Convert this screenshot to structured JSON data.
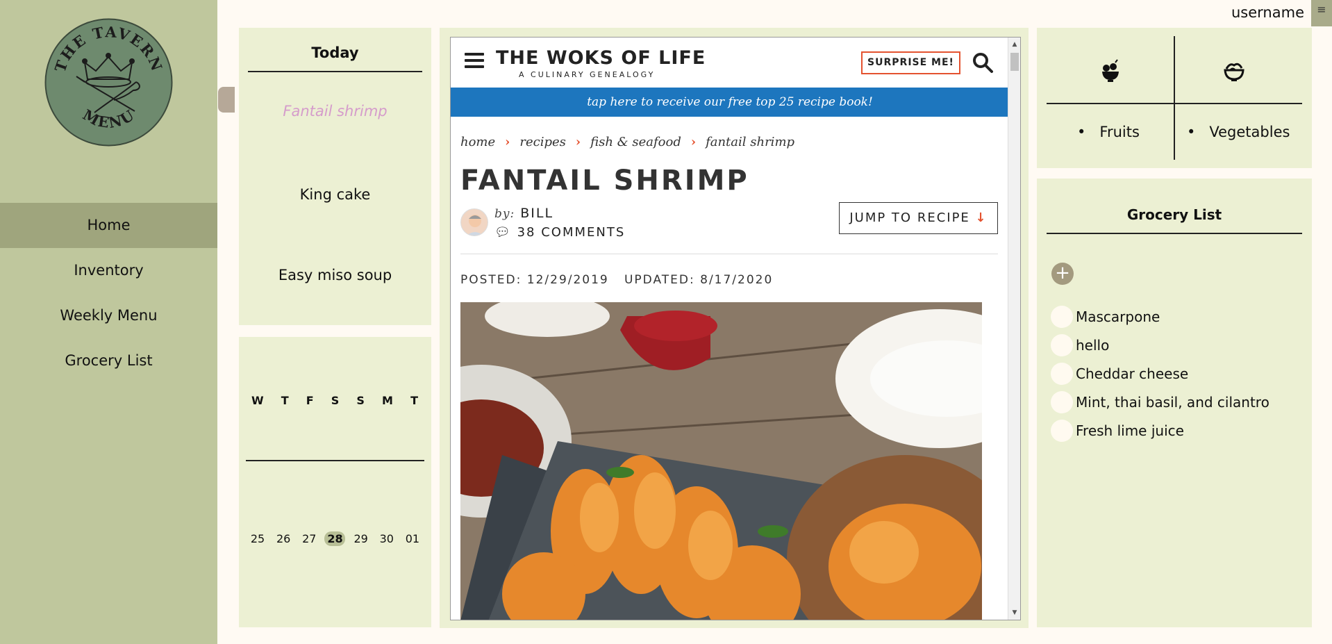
{
  "sidebar": {
    "logo": {
      "top_text": "THE TAVERN",
      "bottom_text": "MENU"
    },
    "nav": [
      {
        "label": "Home",
        "active": true
      },
      {
        "label": "Inventory",
        "active": false
      },
      {
        "label": "Weekly Menu",
        "active": false
      },
      {
        "label": "Grocery List",
        "active": false
      }
    ]
  },
  "topbar": {
    "username": "username",
    "menu_icon": "≡"
  },
  "today": {
    "title": "Today",
    "dishes": [
      "Fantail shrimp",
      "King cake",
      "Easy miso soup"
    ]
  },
  "calendar": {
    "weekdays": [
      "W",
      "T",
      "F",
      "S",
      "S",
      "M",
      "T"
    ],
    "dates": [
      "25",
      "26",
      "27",
      "28",
      "29",
      "30",
      "01"
    ],
    "current_date": "28"
  },
  "browser": {
    "site_title": "THE WOKS OF LIFE",
    "site_subtitle": "A CULINARY GENEALOGY",
    "surprise_button": "SURPRISE ME!",
    "banner": "tap here to receive our free top 25 recipe book!",
    "breadcrumb": [
      "home",
      "recipes",
      "fish & seafood",
      "fantail shrimp"
    ],
    "recipe_title": "FANTAIL SHRIMP",
    "by_label": "by:",
    "author": "BILL",
    "comments": "38 COMMENTS",
    "jump_button": "JUMP TO RECIPE",
    "posted": "POSTED: 12/29/2019",
    "updated": "UPDATED: 8/17/2020"
  },
  "categories": [
    {
      "label": "Fruits",
      "icon": "fruit-bowl-icon"
    },
    {
      "label": "Vegetables",
      "icon": "salad-bowl-icon"
    }
  ],
  "grocery": {
    "title": "Grocery List",
    "add_label": "+",
    "items": [
      "Mascarpone",
      "hello",
      "Cheddar cheese",
      "Mint, thai basil, and cilantro",
      "Fresh lime juice"
    ]
  },
  "colors": {
    "sidebar_bg": "#bfc79d",
    "nav_active": "#9fa57d",
    "panel_bg": "#ecf0d3",
    "page_bg": "#fffaf3",
    "accent_pink": "#d59ccb",
    "banner_blue": "#1d76be",
    "site_orange": "#e4522f"
  }
}
